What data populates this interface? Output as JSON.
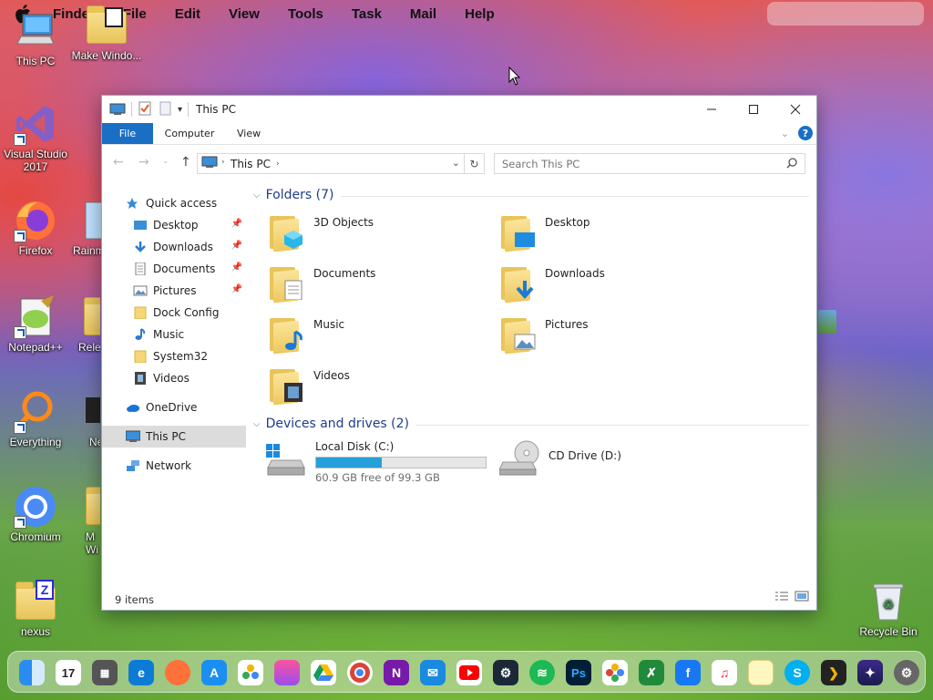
{
  "menubar": {
    "items": [
      "Finder",
      "File",
      "Edit",
      "View",
      "Tools",
      "Task",
      "Mail",
      "Help"
    ]
  },
  "desktop": {
    "icons": [
      "This PC",
      "Make Windo...",
      "Visual Studio 2017",
      "Firefox",
      "Rainm",
      "Notepad++",
      "Relea",
      "Everything",
      "Ne",
      "Chromium",
      "M Wi",
      "nexus",
      "Recycle Bin"
    ]
  },
  "window": {
    "title": "This PC",
    "ribbon": {
      "file": "File",
      "computer": "Computer",
      "view": "View",
      "help": "?"
    },
    "address": {
      "location": "This PC"
    },
    "search": {
      "placeholder": "Search This PC"
    },
    "nav": {
      "quick_access": "Quick access",
      "items": [
        "Desktop",
        "Downloads",
        "Documents",
        "Pictures",
        "Dock Config",
        "Music",
        "System32",
        "Videos"
      ],
      "onedrive": "OneDrive",
      "thispc": "This PC",
      "network": "Network"
    },
    "folders_header": "Folders (7)",
    "folders": [
      "3D Objects",
      "Desktop",
      "Documents",
      "Downloads",
      "Music",
      "Pictures",
      "Videos"
    ],
    "devices_header": "Devices and drives (2)",
    "drives": [
      {
        "name": "Local Disk (C:)",
        "free": "60.9 GB free of 99.3 GB",
        "used_fraction": 0.387
      },
      {
        "name": "CD Drive (D:)"
      }
    ],
    "status": "9 items"
  },
  "colors": {
    "accent": "#1a6fc4",
    "bar": "#26a0da",
    "group": "#1e3c8a"
  }
}
